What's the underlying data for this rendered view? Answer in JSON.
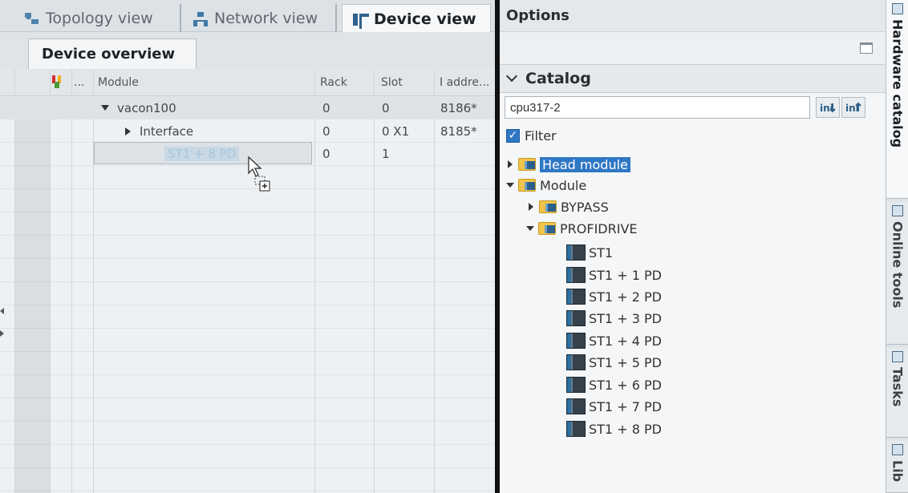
{
  "view_tabs": [
    {
      "label": "Topology view",
      "icon": "topology-icon"
    },
    {
      "label": "Network view",
      "icon": "network-icon"
    },
    {
      "label": "Device view",
      "icon": "device-icon",
      "active": true
    }
  ],
  "device_overview": {
    "tab_label": "Device overview",
    "columns": {
      "dots": "...",
      "module": "Module",
      "rack": "Rack",
      "slot": "Slot",
      "address": "I addre..."
    },
    "rows": [
      {
        "module": "vacon100",
        "rack": "0",
        "slot": "0",
        "address": "8186*",
        "expanded": true
      },
      {
        "module": "Interface",
        "rack": "0",
        "slot": "0 X1",
        "address": "8185*",
        "expanded": false
      },
      {
        "module": "ST1 + 8 PD",
        "rack": "0",
        "slot": "1",
        "address": "",
        "dragging": true
      }
    ]
  },
  "options": {
    "title": "Options",
    "catalog": {
      "title": "Catalog",
      "search_value": "cpu317-2",
      "filter_label": "Filter",
      "filter_checked": true,
      "tree": {
        "head_module": "Head module",
        "module": "Module",
        "bypass": "BYPASS",
        "profidrive": "PROFIDRIVE",
        "items": [
          "ST1",
          "ST1 + 1 PD",
          "ST1 + 2 PD",
          "ST1 + 3 PD",
          "ST1 + 4 PD",
          "ST1 + 5 PD",
          "ST1 + 6 PD",
          "ST1 + 7 PD",
          "ST1 + 8 PD"
        ]
      }
    }
  },
  "side_tabs": [
    "Hardware catalog",
    "Online tools",
    "Tasks",
    "Lib"
  ],
  "colors": {
    "selection": "#2f78c3",
    "divider": "#111111"
  }
}
